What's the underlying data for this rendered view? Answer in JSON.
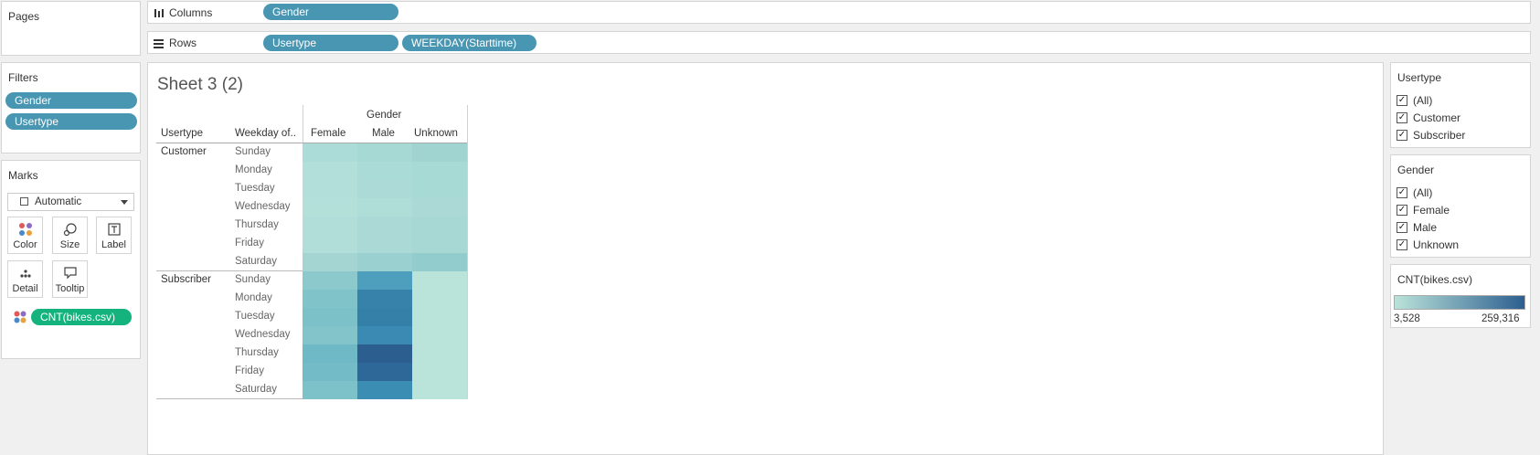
{
  "pages": {
    "title": "Pages"
  },
  "shelves": {
    "columns_label": "Columns",
    "rows_label": "Rows",
    "columns_pills": [
      "Gender"
    ],
    "rows_pills": [
      "Usertype",
      "WEEKDAY(Starttime)"
    ]
  },
  "filters": {
    "title": "Filters",
    "pills": [
      "Gender",
      "Usertype"
    ]
  },
  "marks": {
    "title": "Marks",
    "type": "Automatic",
    "buttons": [
      "Color",
      "Size",
      "Label",
      "Detail",
      "Tooltip"
    ],
    "field_pill": "CNT(bikes.csv)"
  },
  "sheet": {
    "title": "Sheet 3 (2)",
    "col_group_header": "Gender",
    "row_header_1": "Usertype",
    "row_header_2": "Weekday of..",
    "col_headers": [
      "Female",
      "Male",
      "Unknown"
    ],
    "groups": [
      {
        "name": "Customer",
        "days": [
          "Sunday",
          "Monday",
          "Tuesday",
          "Wednesday",
          "Thursday",
          "Friday",
          "Saturday"
        ],
        "colors": [
          [
            "#acdcd7",
            "#a6d8d4",
            "#a0d4d1"
          ],
          [
            "#b2dfd9",
            "#abdbd6",
            "#a7d9d5"
          ],
          [
            "#b2dfd9",
            "#acdbd7",
            "#a7d9d5"
          ],
          [
            "#b4e0da",
            "#afddd8",
            "#aad9d6"
          ],
          [
            "#b1ded9",
            "#abdad6",
            "#a7d8d4"
          ],
          [
            "#b1ded9",
            "#aad9d6",
            "#a7d8d4"
          ],
          [
            "#a4d5d3",
            "#9ad0cf",
            "#93cccd"
          ]
        ]
      },
      {
        "name": "Subscriber",
        "days": [
          "Sunday",
          "Monday",
          "Tuesday",
          "Wednesday",
          "Thursday",
          "Friday",
          "Saturday"
        ],
        "colors": [
          [
            "#8cc9cd",
            "#4e9fbd",
            "#bae3da"
          ],
          [
            "#80c3c9",
            "#3682ab",
            "#bae3da"
          ],
          [
            "#7dc1c8",
            "#3480a9",
            "#bae3da"
          ],
          [
            "#82c4ca",
            "#3a8ab3",
            "#bae3da"
          ],
          [
            "#6fb8c5",
            "#2c5f90",
            "#bae3da"
          ],
          [
            "#73bbc6",
            "#2e6898",
            "#bae3da"
          ],
          [
            "#7ec2c9",
            "#3b8db4",
            "#bae3da"
          ]
        ]
      }
    ]
  },
  "usertype_filter": {
    "title": "Usertype",
    "options": [
      "(All)",
      "Customer",
      "Subscriber"
    ]
  },
  "gender_filter": {
    "title": "Gender",
    "options": [
      "(All)",
      "Female",
      "Male",
      "Unknown"
    ]
  },
  "legend": {
    "title": "CNT(bikes.csv)",
    "min": "3,528",
    "max": "259,316",
    "color_start": "#bae3da",
    "color_end": "#2c5f90"
  }
}
